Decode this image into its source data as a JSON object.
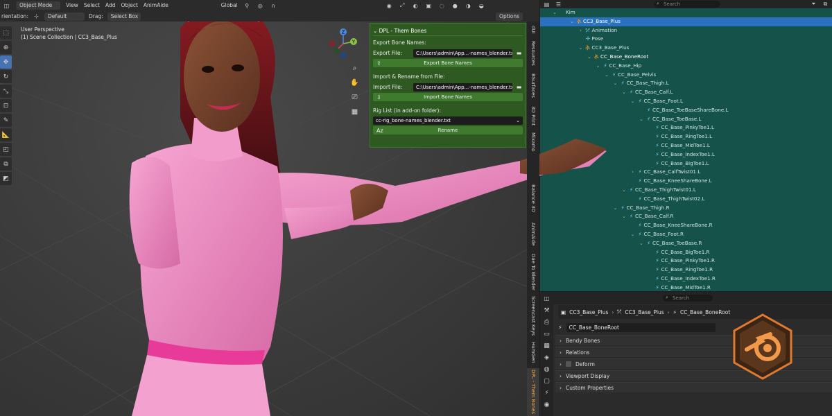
{
  "header": {
    "orientation_label": "rientation:",
    "orientation_value": "Default",
    "drag_label": "Drag:",
    "drag_value": "Select Box",
    "mode": "Object Mode",
    "menus": [
      "View",
      "Select",
      "Add",
      "Object",
      "AnimAide"
    ],
    "transform_orientation": "Global",
    "options": "Options"
  },
  "viewport": {
    "perspective": "User Perspective",
    "collection": "(1) Scene Collection | CC3_Base_Plus"
  },
  "gizmo": {
    "x_color": "#e0435a",
    "y_color": "#8bc34a",
    "z_color": "#4a8be0"
  },
  "npanel": {
    "title": "DPL - Them Bones",
    "export_section": "Export Bone Names:",
    "export_file_label": "Export File:",
    "export_file_value": "C:\\Users\\admin\\App...-names_blender.txt",
    "export_button": "Export Bone Names",
    "import_section": "Import & Rename from File:",
    "import_file_label": "Import File:",
    "import_file_value": "C:\\Users\\admin\\App...-names_blender.txt",
    "import_button": "Import Bone Names",
    "rig_list_label": "Rig List (in add-on folder):",
    "rig_list_value": "cc-rig_bone-names_blender.txt",
    "rename_button": "Rename"
  },
  "vertical_tabs": [
    "dUI",
    "Resources",
    "BSurfaces",
    "3D Print",
    "Mixamo",
    "Balance 3D",
    "AnimAide",
    "Dae To Blender",
    "Screencast Keys",
    "HumGen",
    "DPL - Them Bones"
  ],
  "outliner": {
    "search_placeholder": "Search",
    "rows": [
      {
        "label": "Kim",
        "indent": 0,
        "chev": "⌄",
        "icon": ""
      },
      {
        "label": "CC3_Base_Plus",
        "indent": 2,
        "chev": "⌄",
        "icon": "⛹",
        "selected": true
      },
      {
        "label": "Animation",
        "indent": 3,
        "chev": "›",
        "icon": "⤱"
      },
      {
        "label": "Pose",
        "indent": 3,
        "chev": "",
        "icon": "✢"
      },
      {
        "label": "CC3_Base_Plus",
        "indent": 3,
        "chev": "⌄",
        "icon": "⛹"
      },
      {
        "label": "CC_Base_BoneRoot",
        "indent": 4,
        "chev": "⌄",
        "icon": "⛹",
        "highlight": true
      },
      {
        "label": "CC_Base_Hip",
        "indent": 5,
        "chev": "⌄",
        "icon": "⚡"
      },
      {
        "label": "CC_Base_Pelvis",
        "indent": 6,
        "chev": "⌄",
        "icon": "⚡"
      },
      {
        "label": "CC_Base_Thigh.L",
        "indent": 7,
        "chev": "⌄",
        "icon": "⚡"
      },
      {
        "label": "CC_Base_Calf.L",
        "indent": 8,
        "chev": "⌄",
        "icon": "⚡"
      },
      {
        "label": "CC_Base_Foot.L",
        "indent": 9,
        "chev": "⌄",
        "icon": "⚡"
      },
      {
        "label": "CC_Base_ToeBaseShareBone.L",
        "indent": 10,
        "chev": "",
        "icon": "⚡"
      },
      {
        "label": "CC_Base_ToeBase.L",
        "indent": 10,
        "chev": "⌄",
        "icon": "⚡"
      },
      {
        "label": "CC_Base_PinkyToe1.L",
        "indent": 11,
        "chev": "",
        "icon": "⚡"
      },
      {
        "label": "CC_Base_RingToe1.L",
        "indent": 11,
        "chev": "",
        "icon": "⚡"
      },
      {
        "label": "CC_Base_MidToe1.L",
        "indent": 11,
        "chev": "",
        "icon": "⚡"
      },
      {
        "label": "CC_Base_IndexToe1.L",
        "indent": 11,
        "chev": "",
        "icon": "⚡"
      },
      {
        "label": "CC_Base_BigToe1.L",
        "indent": 11,
        "chev": "",
        "icon": "⚡"
      },
      {
        "label": "CC_Base_CalfTwist01.L",
        "indent": 9,
        "chev": "›",
        "icon": "⚡"
      },
      {
        "label": "CC_Base_KneeShareBone.L",
        "indent": 9,
        "chev": "",
        "icon": "⚡"
      },
      {
        "label": "CC_Base_ThighTwist01.L",
        "indent": 8,
        "chev": "⌄",
        "icon": "⚡"
      },
      {
        "label": "CC_Base_ThighTwist02.L",
        "indent": 9,
        "chev": "",
        "icon": "⚡"
      },
      {
        "label": "CC_Base_Thigh.R",
        "indent": 7,
        "chev": "⌄",
        "icon": "⚡"
      },
      {
        "label": "CC_Base_Calf.R",
        "indent": 8,
        "chev": "⌄",
        "icon": "⚡"
      },
      {
        "label": "CC_Base_KneeShareBone.R",
        "indent": 9,
        "chev": "",
        "icon": "⚡"
      },
      {
        "label": "CC_Base_Foot.R",
        "indent": 9,
        "chev": "⌄",
        "icon": "⚡"
      },
      {
        "label": "CC_Base_ToeBase.R",
        "indent": 10,
        "chev": "⌄",
        "icon": "⚡"
      },
      {
        "label": "CC_Base_BigToe1.R",
        "indent": 11,
        "chev": "",
        "icon": "⚡"
      },
      {
        "label": "CC_Base_PinkyToe1.R",
        "indent": 11,
        "chev": "",
        "icon": "⚡"
      },
      {
        "label": "CC_Base_RingToe1.R",
        "indent": 11,
        "chev": "",
        "icon": "⚡"
      },
      {
        "label": "CC_Base_IndexToe1.R",
        "indent": 11,
        "chev": "",
        "icon": "⚡"
      },
      {
        "label": "CC_Base_MidToe1.R",
        "indent": 11,
        "chev": "",
        "icon": "⚡"
      }
    ]
  },
  "properties": {
    "search_placeholder": "Search",
    "breadcrumb": [
      "CC3_Base_Plus",
      "CC3_Base_Plus",
      "CC_Base_BoneRoot"
    ],
    "bone_name": "CC_Base_BoneRoot",
    "panels": [
      "Bendy Bones",
      "Relations",
      "Deform",
      "Viewport Display",
      "Custom Properties"
    ]
  }
}
